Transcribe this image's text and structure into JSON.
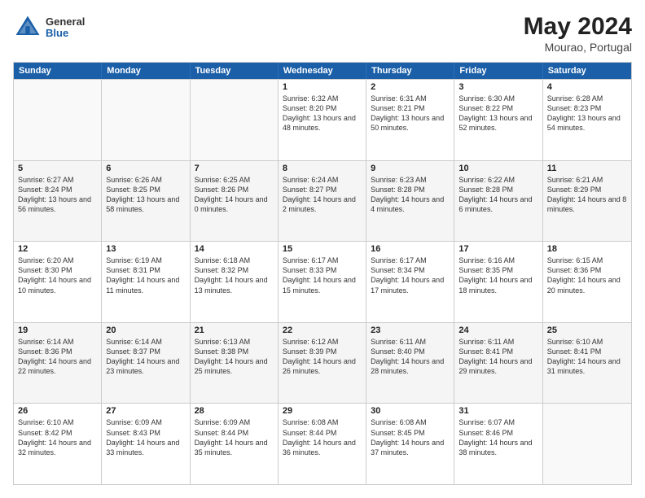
{
  "header": {
    "logo": {
      "general": "General",
      "blue": "Blue"
    },
    "title": "May 2024",
    "location": "Mourao, Portugal"
  },
  "days_of_week": [
    "Sunday",
    "Monday",
    "Tuesday",
    "Wednesday",
    "Thursday",
    "Friday",
    "Saturday"
  ],
  "weeks": [
    [
      {
        "day": "",
        "sunrise": "",
        "sunset": "",
        "daylight": "",
        "empty": true
      },
      {
        "day": "",
        "sunrise": "",
        "sunset": "",
        "daylight": "",
        "empty": true
      },
      {
        "day": "",
        "sunrise": "",
        "sunset": "",
        "daylight": "",
        "empty": true
      },
      {
        "day": "1",
        "sunrise": "Sunrise: 6:32 AM",
        "sunset": "Sunset: 8:20 PM",
        "daylight": "Daylight: 13 hours and 48 minutes.",
        "empty": false
      },
      {
        "day": "2",
        "sunrise": "Sunrise: 6:31 AM",
        "sunset": "Sunset: 8:21 PM",
        "daylight": "Daylight: 13 hours and 50 minutes.",
        "empty": false
      },
      {
        "day": "3",
        "sunrise": "Sunrise: 6:30 AM",
        "sunset": "Sunset: 8:22 PM",
        "daylight": "Daylight: 13 hours and 52 minutes.",
        "empty": false
      },
      {
        "day": "4",
        "sunrise": "Sunrise: 6:28 AM",
        "sunset": "Sunset: 8:23 PM",
        "daylight": "Daylight: 13 hours and 54 minutes.",
        "empty": false
      }
    ],
    [
      {
        "day": "5",
        "sunrise": "Sunrise: 6:27 AM",
        "sunset": "Sunset: 8:24 PM",
        "daylight": "Daylight: 13 hours and 56 minutes.",
        "empty": false
      },
      {
        "day": "6",
        "sunrise": "Sunrise: 6:26 AM",
        "sunset": "Sunset: 8:25 PM",
        "daylight": "Daylight: 13 hours and 58 minutes.",
        "empty": false
      },
      {
        "day": "7",
        "sunrise": "Sunrise: 6:25 AM",
        "sunset": "Sunset: 8:26 PM",
        "daylight": "Daylight: 14 hours and 0 minutes.",
        "empty": false
      },
      {
        "day": "8",
        "sunrise": "Sunrise: 6:24 AM",
        "sunset": "Sunset: 8:27 PM",
        "daylight": "Daylight: 14 hours and 2 minutes.",
        "empty": false
      },
      {
        "day": "9",
        "sunrise": "Sunrise: 6:23 AM",
        "sunset": "Sunset: 8:28 PM",
        "daylight": "Daylight: 14 hours and 4 minutes.",
        "empty": false
      },
      {
        "day": "10",
        "sunrise": "Sunrise: 6:22 AM",
        "sunset": "Sunset: 8:28 PM",
        "daylight": "Daylight: 14 hours and 6 minutes.",
        "empty": false
      },
      {
        "day": "11",
        "sunrise": "Sunrise: 6:21 AM",
        "sunset": "Sunset: 8:29 PM",
        "daylight": "Daylight: 14 hours and 8 minutes.",
        "empty": false
      }
    ],
    [
      {
        "day": "12",
        "sunrise": "Sunrise: 6:20 AM",
        "sunset": "Sunset: 8:30 PM",
        "daylight": "Daylight: 14 hours and 10 minutes.",
        "empty": false
      },
      {
        "day": "13",
        "sunrise": "Sunrise: 6:19 AM",
        "sunset": "Sunset: 8:31 PM",
        "daylight": "Daylight: 14 hours and 11 minutes.",
        "empty": false
      },
      {
        "day": "14",
        "sunrise": "Sunrise: 6:18 AM",
        "sunset": "Sunset: 8:32 PM",
        "daylight": "Daylight: 14 hours and 13 minutes.",
        "empty": false
      },
      {
        "day": "15",
        "sunrise": "Sunrise: 6:17 AM",
        "sunset": "Sunset: 8:33 PM",
        "daylight": "Daylight: 14 hours and 15 minutes.",
        "empty": false
      },
      {
        "day": "16",
        "sunrise": "Sunrise: 6:17 AM",
        "sunset": "Sunset: 8:34 PM",
        "daylight": "Daylight: 14 hours and 17 minutes.",
        "empty": false
      },
      {
        "day": "17",
        "sunrise": "Sunrise: 6:16 AM",
        "sunset": "Sunset: 8:35 PM",
        "daylight": "Daylight: 14 hours and 18 minutes.",
        "empty": false
      },
      {
        "day": "18",
        "sunrise": "Sunrise: 6:15 AM",
        "sunset": "Sunset: 8:36 PM",
        "daylight": "Daylight: 14 hours and 20 minutes.",
        "empty": false
      }
    ],
    [
      {
        "day": "19",
        "sunrise": "Sunrise: 6:14 AM",
        "sunset": "Sunset: 8:36 PM",
        "daylight": "Daylight: 14 hours and 22 minutes.",
        "empty": false
      },
      {
        "day": "20",
        "sunrise": "Sunrise: 6:14 AM",
        "sunset": "Sunset: 8:37 PM",
        "daylight": "Daylight: 14 hours and 23 minutes.",
        "empty": false
      },
      {
        "day": "21",
        "sunrise": "Sunrise: 6:13 AM",
        "sunset": "Sunset: 8:38 PM",
        "daylight": "Daylight: 14 hours and 25 minutes.",
        "empty": false
      },
      {
        "day": "22",
        "sunrise": "Sunrise: 6:12 AM",
        "sunset": "Sunset: 8:39 PM",
        "daylight": "Daylight: 14 hours and 26 minutes.",
        "empty": false
      },
      {
        "day": "23",
        "sunrise": "Sunrise: 6:11 AM",
        "sunset": "Sunset: 8:40 PM",
        "daylight": "Daylight: 14 hours and 28 minutes.",
        "empty": false
      },
      {
        "day": "24",
        "sunrise": "Sunrise: 6:11 AM",
        "sunset": "Sunset: 8:41 PM",
        "daylight": "Daylight: 14 hours and 29 minutes.",
        "empty": false
      },
      {
        "day": "25",
        "sunrise": "Sunrise: 6:10 AM",
        "sunset": "Sunset: 8:41 PM",
        "daylight": "Daylight: 14 hours and 31 minutes.",
        "empty": false
      }
    ],
    [
      {
        "day": "26",
        "sunrise": "Sunrise: 6:10 AM",
        "sunset": "Sunset: 8:42 PM",
        "daylight": "Daylight: 14 hours and 32 minutes.",
        "empty": false
      },
      {
        "day": "27",
        "sunrise": "Sunrise: 6:09 AM",
        "sunset": "Sunset: 8:43 PM",
        "daylight": "Daylight: 14 hours and 33 minutes.",
        "empty": false
      },
      {
        "day": "28",
        "sunrise": "Sunrise: 6:09 AM",
        "sunset": "Sunset: 8:44 PM",
        "daylight": "Daylight: 14 hours and 35 minutes.",
        "empty": false
      },
      {
        "day": "29",
        "sunrise": "Sunrise: 6:08 AM",
        "sunset": "Sunset: 8:44 PM",
        "daylight": "Daylight: 14 hours and 36 minutes.",
        "empty": false
      },
      {
        "day": "30",
        "sunrise": "Sunrise: 6:08 AM",
        "sunset": "Sunset: 8:45 PM",
        "daylight": "Daylight: 14 hours and 37 minutes.",
        "empty": false
      },
      {
        "day": "31",
        "sunrise": "Sunrise: 6:07 AM",
        "sunset": "Sunset: 8:46 PM",
        "daylight": "Daylight: 14 hours and 38 minutes.",
        "empty": false
      },
      {
        "day": "",
        "sunrise": "",
        "sunset": "",
        "daylight": "",
        "empty": true
      }
    ]
  ]
}
